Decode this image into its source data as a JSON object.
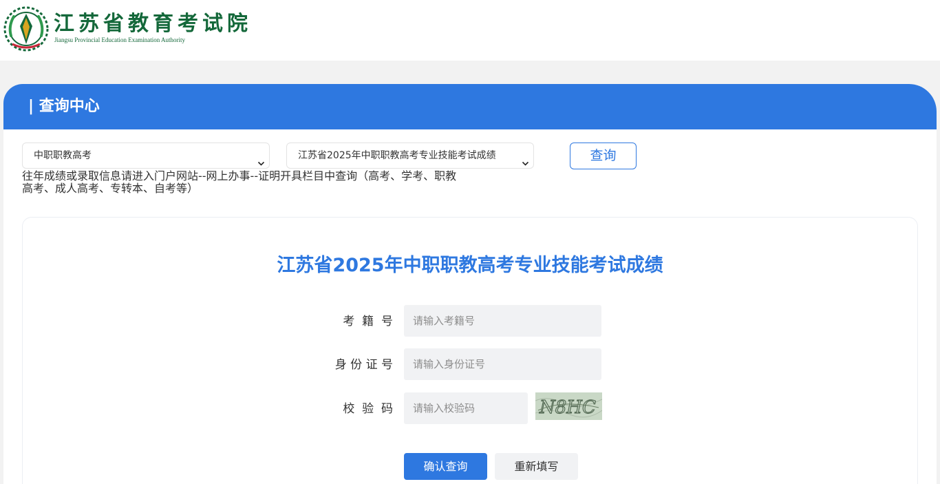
{
  "header": {
    "title": "江苏省教育考试院",
    "subtitle": "Jiangsu Provincial Education Examination Authority",
    "logo_icon": "provincial-emblem-logo"
  },
  "panel": {
    "title": "| 查询中心",
    "exam_type_select": {
      "value": "中职职教高考"
    },
    "exam_name_select": {
      "value": "江苏省2025年中职职教高考专业技能考试成绩"
    },
    "query_button": "查询",
    "notice": "往年成绩或录取信息请进入门户网站--网上办事--证明开具栏目中查询（高考、学考、职教高考、成人高考、专转本、自考等）"
  },
  "form": {
    "title": "江苏省2025年中职职教高考专业技能考试成绩",
    "exam_number": {
      "label": "考  籍  号",
      "placeholder": "请输入考籍号"
    },
    "id_number": {
      "label": "身 份 证 号",
      "placeholder": "请输入身份证号"
    },
    "verify_code": {
      "label": "校  验  码",
      "placeholder": "请输入校验码",
      "captcha_text": "N8HC"
    },
    "confirm_button": "确认查询",
    "reset_button": "重新填写"
  },
  "colors": {
    "brand_green": "#14683a",
    "primary_blue": "#2e78e0",
    "page_background": "#f2f2f2",
    "input_background": "#f1f2f4"
  }
}
